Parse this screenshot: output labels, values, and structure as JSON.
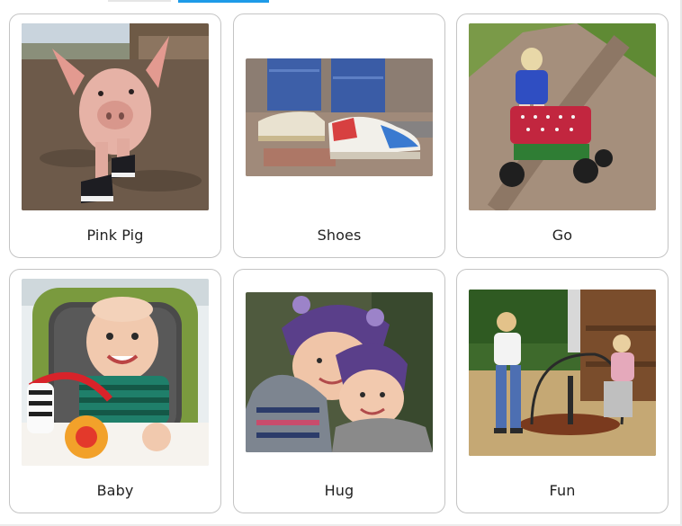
{
  "cards": [
    {
      "label": "Pink Pig",
      "image": "pink-pig-photo"
    },
    {
      "label": "Shoes",
      "image": "shoes-photo"
    },
    {
      "label": "Go",
      "image": "child-pulling-wagon-photo"
    },
    {
      "label": "Baby",
      "image": "baby-with-toy-photo"
    },
    {
      "label": "Hug",
      "image": "children-hugging-photo"
    },
    {
      "label": "Fun",
      "image": "children-playground-photo"
    }
  ],
  "tab_accent": "#1e9be8",
  "card_border": "#c4c4c4"
}
